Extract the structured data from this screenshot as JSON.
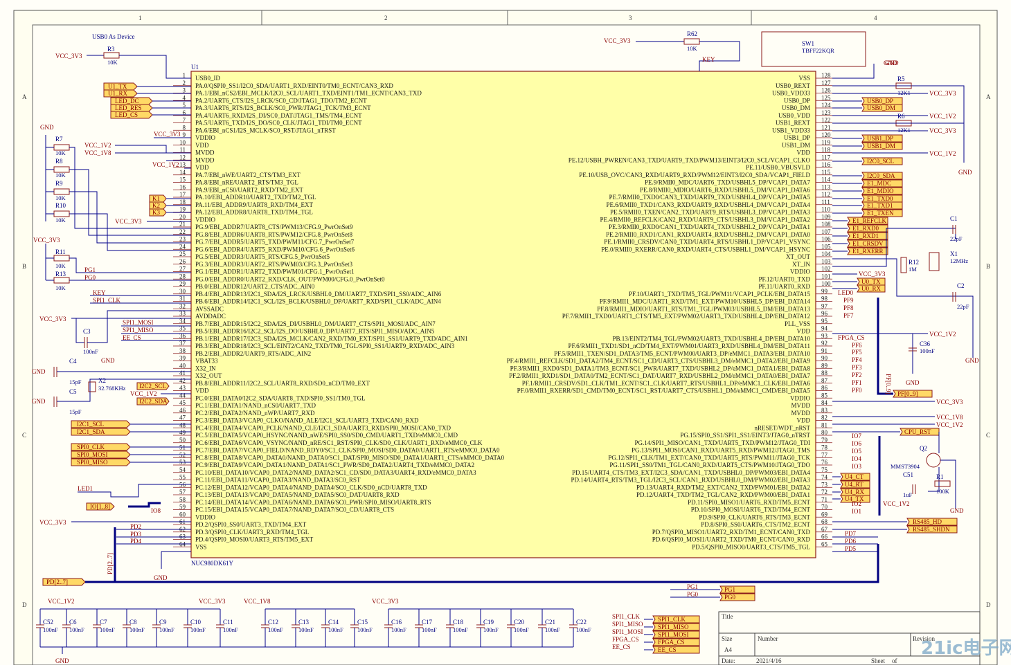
{
  "sheet": {
    "zones_x": [
      "1",
      "2",
      "3",
      "4"
    ],
    "zones_y": [
      "A",
      "B",
      "C",
      "D"
    ],
    "usb_note": "USB0 As Device"
  },
  "chip": {
    "ref": "U1",
    "part": "NUC980DK61Y",
    "left_pins": [
      [
        "1",
        "USB0_ID"
      ],
      [
        "2",
        "PA.0/QSPI0_SS1/I2C0_SDA/UART1_RXD/EINT0/TM0_ECNT/CAN3_RXD"
      ],
      [
        "3",
        "PA.1/EBI_nCS2/EBI_MCLK/I2C0_SCL/UART1_TXD/EINT1/TM1_ECNT/CAN3_TXD"
      ],
      [
        "4",
        "PA.2/UART6_CTS/I2S_LRCK/SC0_CD/JTAG1_TDO/TM2_ECNT"
      ],
      [
        "5",
        "PA.3/UART6_RTS/I2S_BCLK/SC0_PWR/JTAG1_TCK/TM3_ECNT"
      ],
      [
        "6",
        "PA.4/UART6_RXD/I2S_DI/SC0_DAT/JTAG1_TMS/TM4_ECNT"
      ],
      [
        "7",
        "PA.5/UART6_TXD/I2S_DO/SC0_CLK/JTAG1_TDI/TM0_ECNT"
      ],
      [
        "8",
        "PA.6/EBI_nCS1/I2S_MCLK/SC0_RST/JTAG1_nTRST"
      ],
      [
        "9",
        "VDDIO"
      ],
      [
        "10",
        "VDD"
      ],
      [
        "11",
        "MVDD"
      ],
      [
        "12",
        "MVDD"
      ],
      [
        "13",
        "VDD"
      ],
      [
        "14",
        "PA.7/EBI_nWE/UART2_CTS/TM3_EXT"
      ],
      [
        "15",
        "PA.8/EBI_nRE/UART2_RTS/TM3_TGL"
      ],
      [
        "16",
        "PA.9/EBI_nCS0/UART2_RXD/TM2_EXT"
      ],
      [
        "17",
        "PA.10/EBI_ADDR10/UART2_TXD/TM2_TGL"
      ],
      [
        "18",
        "PA.11/EBI_ADDR9/UART8_RXD/TM4_EXT"
      ],
      [
        "19",
        "PA.12/EBI_ADDR8/UART8_TXD/TM4_TGL"
      ],
      [
        "20",
        "VDDIO"
      ],
      [
        "21",
        "PG.9/EBI_ADDR7/UART8_CTS/PWM13/CFG.9_PwrOnSet9"
      ],
      [
        "22",
        "PG.8/EBI_ADDR6/UART8_RTS/PWM12/CFG.8_PwrOnSet8"
      ],
      [
        "23",
        "PG.7/EBI_ADDR5/UART5_TXD/PWM11/CFG.7_PwrOnSet7"
      ],
      [
        "24",
        "PG.6/EBI_ADDR4/UART5_RXD/PWM10/CFG.6_PwrOnSet6"
      ],
      [
        "25",
        "PG.5/EBI_ADDR3/UART5_RTS/CFG.5_PwrOnSet5"
      ],
      [
        "26",
        "PG.3/EBI_ADDR3/UART2_RTS/PWM03/CFG.3_PwrOnSet3"
      ],
      [
        "27",
        "PG.1/EBI_ADDR1/UART2_TXD/PWM01/CFG.1_PwrOnSet1"
      ],
      [
        "28",
        "PG.0/EBI_ADDR0/UART2_RXD/CLK_OUT/PWM00/CFG.0_PwrOnSet0"
      ],
      [
        "29",
        "PB.0/EBI_ADDR12/UART2_CTS/ADC_AIN0"
      ],
      [
        "30",
        "PB.4/EBI_ADDR13/I2C1_SDA/I2S_LRCK/USBHL0_DM/UART7_TXD/SPI1_SS0/ADC_AIN6"
      ],
      [
        "31",
        "PB.6/EBI_ADDR14/I2C1_SCL/I2S_BCLK/USBHL0_DP/UART7_RXD/SPI1_CLK/ADC_AIN4"
      ],
      [
        "32",
        "AVSSADC"
      ],
      [
        "33",
        "AVDDADC"
      ],
      [
        "34",
        "PB.7/EBI_ADDR15/I2C2_SDA/I2S_DI/USBHL0_DM/UART7_CTS/SPI1_MOSI/ADC_AIN7"
      ],
      [
        "35",
        "PB.5/EBI_ADDR16/I2C2_SCL/I2S_DO/USBHL0_DP/UART7_RTS/SPI1_MISO/ADC_AIN5"
      ],
      [
        "36",
        "PB.1/EBI_ADDR17/I2C3_SDA/I2S_MCLK/CAN2_RXD/TM0_EXT/SPI1_SS1/UART9_TXD/ADC_AIN1"
      ],
      [
        "37",
        "PB.3/EBI_ADDR18/I2C3_SCL/EINT2/CAN2_TXD/TM0_TGL/SPI0_SS1/UART9_RXD/ADC_AIN3"
      ],
      [
        "38",
        "PB.2/EBI_ADDR2/UART9_RTS/ADC_AIN2"
      ],
      [
        "39",
        "VBAT33"
      ],
      [
        "40",
        "X32_IN"
      ],
      [
        "41",
        "X32_OUT"
      ],
      [
        "42",
        "PB.8/EBI_ADDR11/I2C2_SCL/UART8_RXD/SD0_nCD/TM0_EXT"
      ],
      [
        "43",
        "VDD"
      ],
      [
        "44",
        "PC.0/EBI_DATA0/I2C2_SDA/UART8_TXD/SPI0_SS1/TM0_TGL"
      ],
      [
        "45",
        "PC.1/EBI_DATA1/NAND_nCS0/UART7_TXD"
      ],
      [
        "46",
        "PC.2/EBI_DATA2/NAND_nWP/UART7_RXD"
      ],
      [
        "47",
        "PC.3/EBI_DATA3/VCAP0_CLKO/NAND_ALE/I2C1_SCL/UART3_TXD/CAN0_RXD"
      ],
      [
        "48",
        "PC.4/EBI_DATA4/VCAP0_PCLK/NAND_CLE/I2C1_SDA/UART3_RXD/SPI0_MOSI/CAN0_TXD"
      ],
      [
        "49",
        "PC.5/EBI_DATA5/VCAP0_HSYNC/NAND_nWE/SPI0_SS0/SD0_CMD/UART1_TXD/eMMC0_CMD"
      ],
      [
        "50",
        "PC.6/EBI_DATA6/VCAP0_VSYNC/NAND_nRE/SC1_RST/SPI0_CLK/SD0_CLK/UART1_RXD/eMMC0_CLK"
      ],
      [
        "51",
        "PC.7/EBI_DATA7/VCAP0_FIELD/NAND_RDY0/SC1_CLK/SPI0_MOSI/SD0_DATA0/UART1_RTS/eMMC0_DATA0"
      ],
      [
        "52",
        "PC.8/EBI_DATA8/VCAP0_DATA0/NAND_DATA0/SC1_DAT/SPI0_MISO/SD0_DATA1/UART1_CTS/eMMC0_DATA0"
      ],
      [
        "53",
        "PC.9/EBI_DATA9/VCAP0_DATA1/NAND_DATA1/SC1_PWR/SD0_DATA2/UART4_TXD/eMMC0_DATA2"
      ],
      [
        "54",
        "PC.10/EBI_DATA10/VCAP0_DATA2/NAND_DATA2/SC1_CD/SD0_DATA3/UART4_RXD/eMMC0_DATA3"
      ],
      [
        "55",
        "PC.11/EBI_DATA11/VCAP0_DATA3/NAND_DATA3/SC0_RST"
      ],
      [
        "56",
        "PC.12/EBI_DATA12/VCAP0_DATA4/NAND_DATA4/SC0_CLK/SD0_nCD/UART8_TXD"
      ],
      [
        "57",
        "PC.13/EBI_DATA13/VCAP0_DATA5/NAND_DATA5/SC0_DAT/UART8_RXD"
      ],
      [
        "58",
        "PC.14/EBI_DATA14/VCAP0_DATA6/NAND_DATA6/SC0_PWR/SPI0_MISO/UART8_RTS"
      ],
      [
        "59",
        "PC.15/EBI_DATA15/VCAP0_DATA7/NAND_DATA7/SC0_CD/UART8_CTS"
      ],
      [
        "60",
        "VDDIO"
      ],
      [
        "61",
        "PD.2/QSPI0_SS0/UART3_TXD/TM4_EXT"
      ],
      [
        "62",
        "PD.3/QSPI0_CLK/UART3_RXD/TM4_TGL"
      ],
      [
        "63",
        "PD.4/QSPI0_MOSI0/UART3_RTS/TM5_EXT"
      ],
      [
        "64",
        "VSS"
      ]
    ],
    "right_pins": [
      [
        "128",
        "VSS"
      ],
      [
        "127",
        "USB0_REXT"
      ],
      [
        "126",
        "USB0_VDD33"
      ],
      [
        "125",
        "USB0_DP"
      ],
      [
        "124",
        "USB0_DM"
      ],
      [
        "123",
        "USB0_VDD"
      ],
      [
        "122",
        "USB1_REXT"
      ],
      [
        "121",
        "USB1_VDD33"
      ],
      [
        "120",
        "USB1_DP"
      ],
      [
        "119",
        "USB1_DM"
      ],
      [
        "118",
        "VDD"
      ],
      [
        "117",
        "PE.12/USBH_PWREN/CAN3_TXD/UART9_TXD/PWM13/EINT3/I2C0_SCL/VCAP1_CLKO"
      ],
      [
        "116",
        "PE.11/USB0_VBUSVLD"
      ],
      [
        "115",
        "PE.10/USB_OVC/CAN3_RXD/UART9_RXD/PWM12/EINT3/I2C0_SDA/VCAP1_FIELD"
      ],
      [
        "114",
        "PE.9/RMII0_MDC/UART6_TXD/USBHL5_DP/VCAP1_DATA7"
      ],
      [
        "113",
        "PE.8/RMII0_MDIO/UART6_RXD/USBHL5_DM/VCAP1_DATA6"
      ],
      [
        "112",
        "PE.7/RMII0_TXD0/CAN3_TXD/UART9_TXD/USBHL4_DP/VCAP1_DATA5"
      ],
      [
        "111",
        "PE.6/RMII0_TXD1/CAN3_RXD/UART9_RXD/USBHL4_DM/VCAP1_DATA4"
      ],
      [
        "110",
        "PE.5/RMII0_TXEN/CAN2_TXD/UART9_RTS/USBHL3_DP/VCAP1_DATA3"
      ],
      [
        "109",
        "PE.4/RMII0_REFCLK/CAN2_RXD/UART9_CTS/USBHL3_DM/VCAP1_DATA2"
      ],
      [
        "108",
        "PE.3/RMII0_RXD0/CAN1_TXD/UART4_TXD/USBHL2_DP/VCAP1_DATA1"
      ],
      [
        "107",
        "PE.2/RMII0_RXD1/CAN1_RXD/UART4_RXD/USBHL2_DM/VCAP1_DATA0"
      ],
      [
        "106",
        "PE.1/RMII0_CRSDV/CAN0_TXD/UART4_RTS/USBHL1_DP/VCAP1_VSYNC"
      ],
      [
        "105",
        "PE.0/RMII0_RXERR/CAN0_RXD/UART4_CTS/USBHL1_DM/VCAP1_HSYNC"
      ],
      [
        "104",
        "XT_OUT"
      ],
      [
        "103",
        "XT_IN"
      ],
      [
        "102",
        "VDDIO"
      ],
      [
        "101",
        "PF.12/UART0_TXD"
      ],
      [
        "100",
        "PF.11/UART0_RXD"
      ],
      [
        "99",
        "PF.10/UART1_TXD/TM5_TGL/PWM11/VCAP1_PCLK/EBI_DATA15"
      ],
      [
        "98",
        "PF.9/RMII1_MDC/UART1_RXD/TM1_EXT/PWM10/USBHL5_DP/EBI_DATA14"
      ],
      [
        "97",
        "PF.8/RMII1_MDIO/UART1_RTS/TM1_TGL/PWM03/USBHL5_DM/EBI_DATA13"
      ],
      [
        "96",
        "PF.7/RMII1_TXD0/UART1_CTS/TM5_EXT/PWM02/UART3_TXD/USBHL4_DP/EBI_DATA12"
      ],
      [
        "95",
        "PLL_VSS"
      ],
      [
        "94",
        "VDD"
      ],
      [
        "93",
        "PB.13/EINT2/TM4_TGL/PWM02/UART3_TXD/USBHL4_DP/EBI_DATA10"
      ],
      [
        "92",
        "PF.6/RMII1_TXD1/SD1_nCD/TM4_EXT/PWM01/UART3_RXD/USBHL4_DM/EBI_DATA11"
      ],
      [
        "91",
        "PF.5/RMII1_TXEN/SD1_DATA3/TM5_ECNT/PWM00/UART3_DP/eMMC1_DATA3/EBI_DATA10"
      ],
      [
        "90",
        "PF.4/RMII1_REFCLK/SD1_DATA2/TM4_ECNT/SC1_CD/UART3_CTS/USBHL3_DM/eMMC1_DATA2/EBI_DATA9"
      ],
      [
        "89",
        "PF.3/RMII1_RXD0/SD1_DATA1/TM3_ECNT/SC1_PWR/UART7_TXD/USBHL2_DP/eMMC1_DATA1/EBI_DATA8"
      ],
      [
        "88",
        "PF.2/RMII1_RXD1/SD1_DATA0/TM2_ECNT/SC1_DAT/UART7_RXD/USBHL2_DM/eMMC1_DATA0/EBI_DATA7"
      ],
      [
        "87",
        "PF.1/RMII1_CRSDV/SD1_CLK/TM1_ECNT/SC1_CLK/UART7_RTS/USBHL1_DP/eMMC1_CLK/EBI_DATA6"
      ],
      [
        "86",
        "PF.0/RMII1_RXERR/SD1_CMD/TM0_ECNT/SC1_RST/UART7_CTS/USBHL1_DM/eMMC1_CMD/EBI_DATA5"
      ],
      [
        "85",
        "VDDIO"
      ],
      [
        "84",
        "MVDD"
      ],
      [
        "83",
        "MVDD"
      ],
      [
        "82",
        "VDD"
      ],
      [
        "81",
        "nRESET/WDT_nRST"
      ],
      [
        "80",
        "PG.15/SPI0_SS1/SPI1_SS1/EINT3/JTAG0_nTRST"
      ],
      [
        "79",
        "PG.14/SPI1_MISO/CAN1_TXD/UART5_TXD/PWM12/JTAG0_TDI"
      ],
      [
        "78",
        "PG.13/SPI1_MOSI/CAN1_RXD/UART5_RXD/PWM12/JTAG0_TMS"
      ],
      [
        "77",
        "PG.12/SPI1_CLK/TM1_EXT/CAN0_TXD/UART5_RTS/PWM11/JTAG0_TCK"
      ],
      [
        "76",
        "PG.11/SPI1_SS0/TM1_TGL/CAN0_RXD/UART5_CTS/PWM10/JTAG0_TDO"
      ],
      [
        "75",
        "PD.15/UART4_CTS/TM3_EXT/I2C3_SDA/CAN1_TXD/USBHL0_DP/PWM03/EBI_DATA4"
      ],
      [
        "74",
        "PD.14/UART4_RTS/TM3_TGL/I2C3_SCL/CAN1_RXD/USBHL0_DM/PWM02/EBI_DATA3"
      ],
      [
        "73",
        "PD.13/UART4_RXD/TM2_EXT/CAN2_TXD/PWM01/EBI_DATA2"
      ],
      [
        "72",
        "PD.12/UART4_TXD/TM2_TGL/CAN2_RXD/PWM00/EBI_DATA1"
      ],
      [
        "71",
        "PD.11/SPI0_MISO1/UART6_RXD/TM5_ECNT"
      ],
      [
        "70",
        "PD.10/SPI0_MOSI/UART6_TXD/TM4_ECNT"
      ],
      [
        "69",
        "PD.9/SPI0_CLK/UART6_RTS/TM3_ECNT"
      ],
      [
        "68",
        "PD.8/SPI0_SS0/UART6_CTS/TM2_ECNT"
      ],
      [
        "67",
        "PD.7/QSPI0_MISO1/UART2_RXD/TM1_ECNT/CAN0_TXD"
      ],
      [
        "66",
        "PD.6/QSPI0_MOSI1/UART2_TXD/TM0_ECNT/CAN0_RXD"
      ],
      [
        "65",
        "PD.5/QSPI0_MISO0/UART3_CTS/TM5_TGL"
      ]
    ]
  },
  "left_tags": {
    "u1_tx": "U1_TX",
    "u1_rx": "U1_RX",
    "led_dc": "LED_DC",
    "led_res": "LED_RES",
    "led_cs": "LED_CS",
    "k1": "K1",
    "k2": "K2",
    "k3": "K3",
    "i2c2_scl": "I2C2_SCL",
    "i2c2_sda": "I2C2_SDA",
    "i2c1_scl": "I2C1_SCL",
    "i2c1_sda": "I2C1_SDA",
    "spi0_clk": "SPI0_CLK",
    "spi0_mosi": "SPI0_MOSI",
    "spi0_miso": "SPI0_MISO",
    "io_bus": "IO[1..8]",
    "pd_bus": "PD[2..7]"
  },
  "right_tags": {
    "usb0_dp": "USB0_DP",
    "usb0_dm": "USB0_DM",
    "usb1_dp": "USB1_DP",
    "usb1_dm": "USB1_DM",
    "i2c0_scl": "I2C0_SCL",
    "i2c0_sda": "I2C0_SDA",
    "e1_mdc": "E1_MDC",
    "e1_mdio": "E1_MDIO",
    "e1_txd0": "E1_TXD0",
    "e1_txd1": "E1_TXD1",
    "e1_txen": "E1_TXEN",
    "e1_refclk": "E1_REFCLK",
    "e1_rxd0": "E1_RXD0",
    "e1_rxd1": "E1_RXD1",
    "e1_crsdv": "E1_CRSDV",
    "e1_rxerr": "E1_RXERR",
    "u0_tx": "U0_TX",
    "u0_rx": "U0_RX",
    "pf_bus": "PF[0..9]",
    "cpu_rst": "CPU_RST",
    "u4_ct": "U4_CT",
    "u4_rt": "U4_RT",
    "u4_rx": "U4_RX",
    "u4_tx": "U4_TX",
    "rs485_hd": "RS485_HD",
    "rs485_shdn": "RS485_SHDN",
    "pg1": "PG1",
    "pg0": "PG0",
    "spi1_clk": "SPI1_CLK",
    "spi1_miso": "SPI1_MISO",
    "spi1_mosi": "SPI1_MOSI",
    "fpga_cs": "FPGA_CS",
    "ee_cs": "EE_CS"
  },
  "nets": {
    "vcc_3v3": "VCC_3V3",
    "vcc_1v2": "VCC_1V2",
    "vcc_1v8": "VCC_1V8",
    "gnd": "GND",
    "key": "KEY",
    "spi1_clk": "SPI1_CLK",
    "spi1_mosi": "SPI1_MOSI",
    "spi1_miso": "SPI1_MISO",
    "ee_cs": "EE_CS",
    "fpga_cs": "FPGA_CS",
    "led1": "LED1",
    "led0": "LED0",
    "pg1": "PG1",
    "pg0": "PG0",
    "io8": "IO8",
    "pd2": "PD2",
    "pd3": "PD3",
    "pd4": "PD4",
    "pd5": "PD5",
    "pd6": "PD6",
    "pd7": "PD7",
    "pd_bus_v": "PD[2..7]",
    "pf_bus_v": "PF[0..9]",
    "pf9": "PF9",
    "pf8": "PF8",
    "pf7": "PF7",
    "pf6": "PF6",
    "pf5": "PF5",
    "pf4": "PF4",
    "pf3": "PF3",
    "pf2": "PF2",
    "pf1": "PF1",
    "pf0": "PF0",
    "io7": "IO7",
    "io6": "IO6",
    "io5": "IO5",
    "io4": "IO4",
    "io3": "IO3",
    "io2": "IO2",
    "io1": "IO1"
  },
  "components": {
    "r3": [
      "R3",
      "10K"
    ],
    "r62": [
      "R62",
      "10K"
    ],
    "sw1": [
      "SW1",
      "TBFF22KQR"
    ],
    "r5": [
      "R5",
      "12K1"
    ],
    "r6": [
      "R6",
      "12K1"
    ],
    "r7": [
      "R7",
      "10K"
    ],
    "r8": [
      "R8",
      "10K"
    ],
    "r9": [
      "R9",
      "10K"
    ],
    "r10": [
      "R10",
      "10K"
    ],
    "r11": [
      "R11",
      "10K"
    ],
    "r13": [
      "R13",
      "10K"
    ],
    "c3": [
      "C3",
      "100nF"
    ],
    "c4": [
      "C4",
      "15pF"
    ],
    "c5": [
      "C5",
      "15pF"
    ],
    "x2": [
      "X2",
      "32.768KHz"
    ],
    "c1": [
      "C1",
      "22pF"
    ],
    "c2": [
      "C2",
      "22pF"
    ],
    "x1": [
      "X1",
      "12MHz"
    ],
    "r12": [
      "R12",
      "1M"
    ],
    "c36": [
      "C36",
      "100nF"
    ],
    "q2": [
      "Q2",
      "MMST3904"
    ],
    "c51": [
      "C51",
      "1uF"
    ],
    "r1": [
      "R1",
      "100K"
    ]
  },
  "decoupling": [
    [
      "C52",
      "100nF"
    ],
    [
      "C6",
      "100nF"
    ],
    [
      "C7",
      "100nF"
    ],
    [
      "C8",
      "100nF"
    ],
    [
      "C9",
      "100nF"
    ],
    [
      "C10",
      "100nF"
    ],
    [
      "C11",
      "100nF"
    ],
    [
      "C12",
      "100nF"
    ],
    [
      "C13",
      "100nF"
    ],
    [
      "C14",
      "100nF"
    ],
    [
      "C15",
      "100nF"
    ],
    [
      "C16",
      "100nF"
    ],
    [
      "C17",
      "100nF"
    ],
    [
      "C18",
      "100nF"
    ],
    [
      "C19",
      "100nF"
    ],
    [
      "C20",
      "100nF"
    ],
    [
      "C21",
      "100nF"
    ],
    [
      "C22",
      "100nF"
    ]
  ],
  "title_block": {
    "title_label": "Title",
    "size_label": "Size",
    "size": "A4",
    "number_label": "Number",
    "revision_label": "Revision",
    "date_label": "Date:",
    "date": "2021/4/16",
    "sheet_label": "Sheet",
    "of_label": "of"
  },
  "watermark": "21ic电子网",
  "colors": {
    "chip_fill": "#ffffa8",
    "chip_border": "#8b1a1a",
    "wire": "#00008b",
    "tag_fill": "#ffd966",
    "net_text": "#8b0000"
  }
}
